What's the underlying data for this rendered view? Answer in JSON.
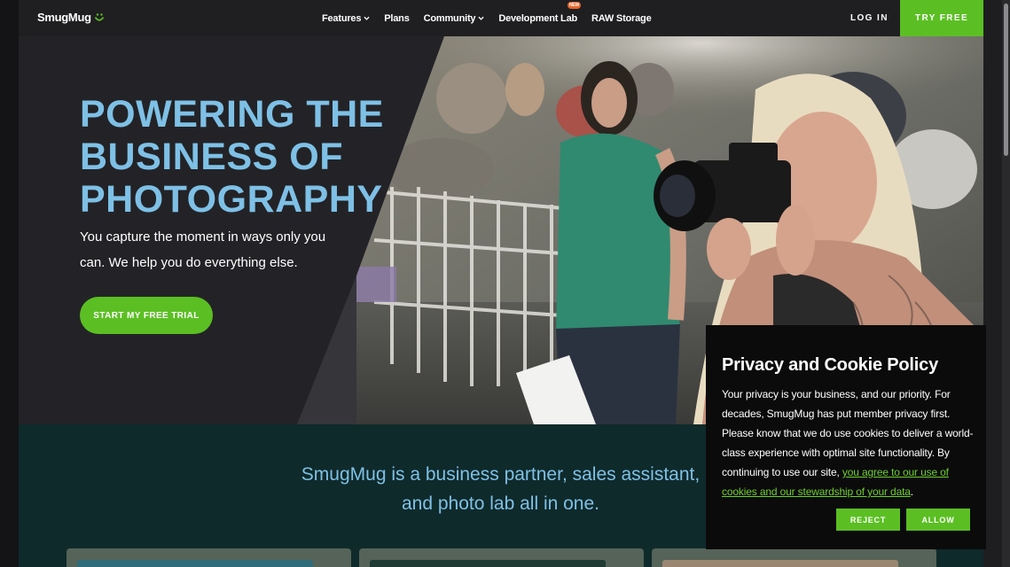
{
  "nav": {
    "logo_text": "SmugMug",
    "logo_icon": "smiley-face-icon",
    "links": [
      {
        "label": "Features",
        "dropdown": true
      },
      {
        "label": "Plans",
        "dropdown": false
      },
      {
        "label": "Community",
        "dropdown": true
      },
      {
        "label": "Development Lab",
        "dropdown": false,
        "badge": "NEW"
      },
      {
        "label": "RAW Storage",
        "dropdown": false
      }
    ],
    "login_label": "LOG IN",
    "try_free_label": "TRY FREE"
  },
  "hero": {
    "title_lines": [
      "POWERING THE",
      "BUSINESS OF",
      "PHOTOGRAPHY"
    ],
    "subtitle": "You capture the moment in ways only you can. We help you do everything else.",
    "cta_label": "START MY FREE TRIAL"
  },
  "section2": {
    "text": "SmugMug is a business partner, sales assistant, and photo lab all in one."
  },
  "cookie": {
    "title": "Privacy and Cookie Policy",
    "body": "Your privacy is your business, and our priority. For decades, SmugMug has put member privacy first. Please know that we do use cookies to deliver a world-class experience with optimal site functionality. By continuing to use our site,",
    "link_text": "you agree to our use of cookies and our stewardship of your data",
    "trailing": ".",
    "reject_label": "REJECT",
    "allow_label": "ALLOW"
  },
  "colors": {
    "accent_green": "#5bbf23",
    "title_blue": "#7ec0e6",
    "dark_bg": "#232327",
    "section_teal": "#0f2a2b"
  }
}
